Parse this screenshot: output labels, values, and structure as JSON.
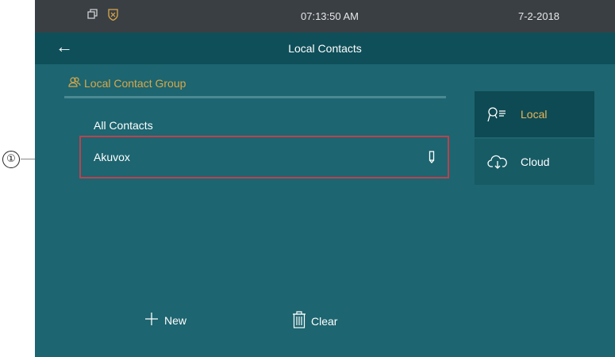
{
  "status_bar": {
    "time": "07:13:50   AM",
    "date": "7-2-2018"
  },
  "header": {
    "back_icon": "arrow-left-icon",
    "title": "Local Contacts"
  },
  "group": {
    "title": "Local Contact Group",
    "icon": "group-icon"
  },
  "contacts": [
    {
      "label": "All Contacts"
    },
    {
      "label": "Akuvox",
      "icon": "edit-icon"
    }
  ],
  "side_tabs": [
    {
      "label": "Local",
      "icon": "contacts-search-icon",
      "selected": true,
      "color": "#e6b65a"
    },
    {
      "label": "Cloud",
      "icon": "cloud-download-icon",
      "selected": false
    }
  ],
  "bottom": {
    "new_label": "New",
    "clear_label": "Clear"
  },
  "callout": {
    "number": "①"
  },
  "colors": {
    "background": "#1d6570",
    "status_bar": "#3a3f44",
    "title_bar": "#0f4f59",
    "accent": "#d9a84a",
    "highlight": "#b8434f"
  }
}
